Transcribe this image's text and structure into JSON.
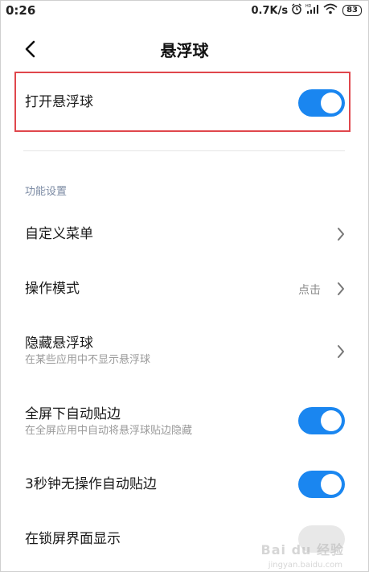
{
  "status_bar": {
    "time": "0:26",
    "speed": "0.7K/s",
    "battery": "83"
  },
  "header": {
    "title": "悬浮球"
  },
  "main_toggle": {
    "label": "打开悬浮球",
    "on": true
  },
  "section": {
    "label": "功能设置"
  },
  "items": [
    {
      "title": "自定义菜单",
      "subtitle": "",
      "value": "",
      "control": "chevron"
    },
    {
      "title": "操作模式",
      "subtitle": "",
      "value": "点击",
      "control": "chevron"
    },
    {
      "title": "隐藏悬浮球",
      "subtitle": "在某些应用中不显示悬浮球",
      "value": "",
      "control": "chevron"
    },
    {
      "title": "全屏下自动贴边",
      "subtitle": "在全屏应用中自动将悬浮球贴边隐藏",
      "value": "",
      "control": "toggle",
      "on": true
    },
    {
      "title": "3秒钟无操作自动贴边",
      "subtitle": "",
      "value": "",
      "control": "toggle",
      "on": true
    },
    {
      "title": "在锁屏界面显示",
      "subtitle": "",
      "value": "",
      "control": "toggle",
      "on": false
    }
  ],
  "watermark": {
    "text": "Bai du 经验",
    "sub": "jingyan.baidu.com"
  },
  "colors": {
    "accent": "#1a86f0",
    "highlight_border": "#e0474c",
    "section_label": "#7b8aa3"
  }
}
